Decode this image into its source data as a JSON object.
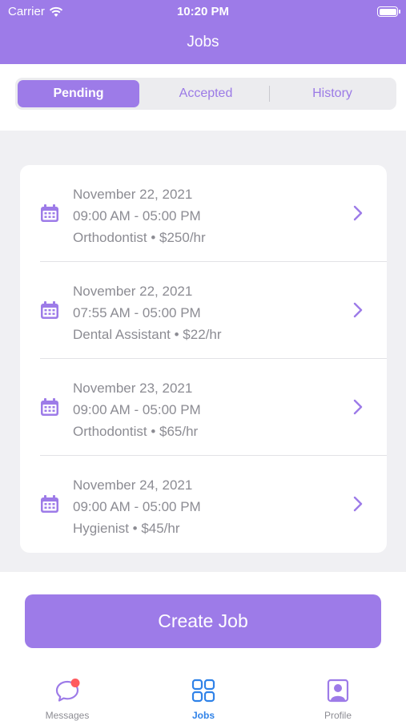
{
  "status_bar": {
    "carrier": "Carrier",
    "time": "10:20 PM"
  },
  "header": {
    "title": "Jobs"
  },
  "segments": [
    {
      "label": "Pending",
      "active": true
    },
    {
      "label": "Accepted",
      "active": false
    },
    {
      "label": "History",
      "active": false
    }
  ],
  "jobs": [
    {
      "date": "November 22, 2021",
      "time": "09:00 AM - 05:00 PM",
      "detail": "Orthodontist • $250/hr",
      "icon": "calendar-icon"
    },
    {
      "date": "November 22, 2021",
      "time": "07:55 AM - 05:00 PM",
      "detail": "Dental Assistant • $22/hr",
      "icon": "calendar-icon"
    },
    {
      "date": "November 23, 2021",
      "time": "09:00 AM - 05:00 PM",
      "detail": "Orthodontist • $65/hr",
      "icon": "calendar-icon"
    },
    {
      "date": "November 24, 2021",
      "time": "09:00 AM - 05:00 PM",
      "detail": "Hygienist • $45/hr",
      "icon": "calendar-icon"
    }
  ],
  "create_button": {
    "label": "Create Job"
  },
  "tabbar": {
    "items": [
      {
        "label": "Messages",
        "icon": "chat-bubble-icon",
        "badge": true
      },
      {
        "label": "Jobs",
        "icon": "grid-icon",
        "active": true
      },
      {
        "label": "Profile",
        "icon": "profile-icon"
      }
    ]
  },
  "colors": {
    "accent": "#9d7be8",
    "tab_active": "#2f82e8",
    "badge": "#ff5a5f"
  }
}
